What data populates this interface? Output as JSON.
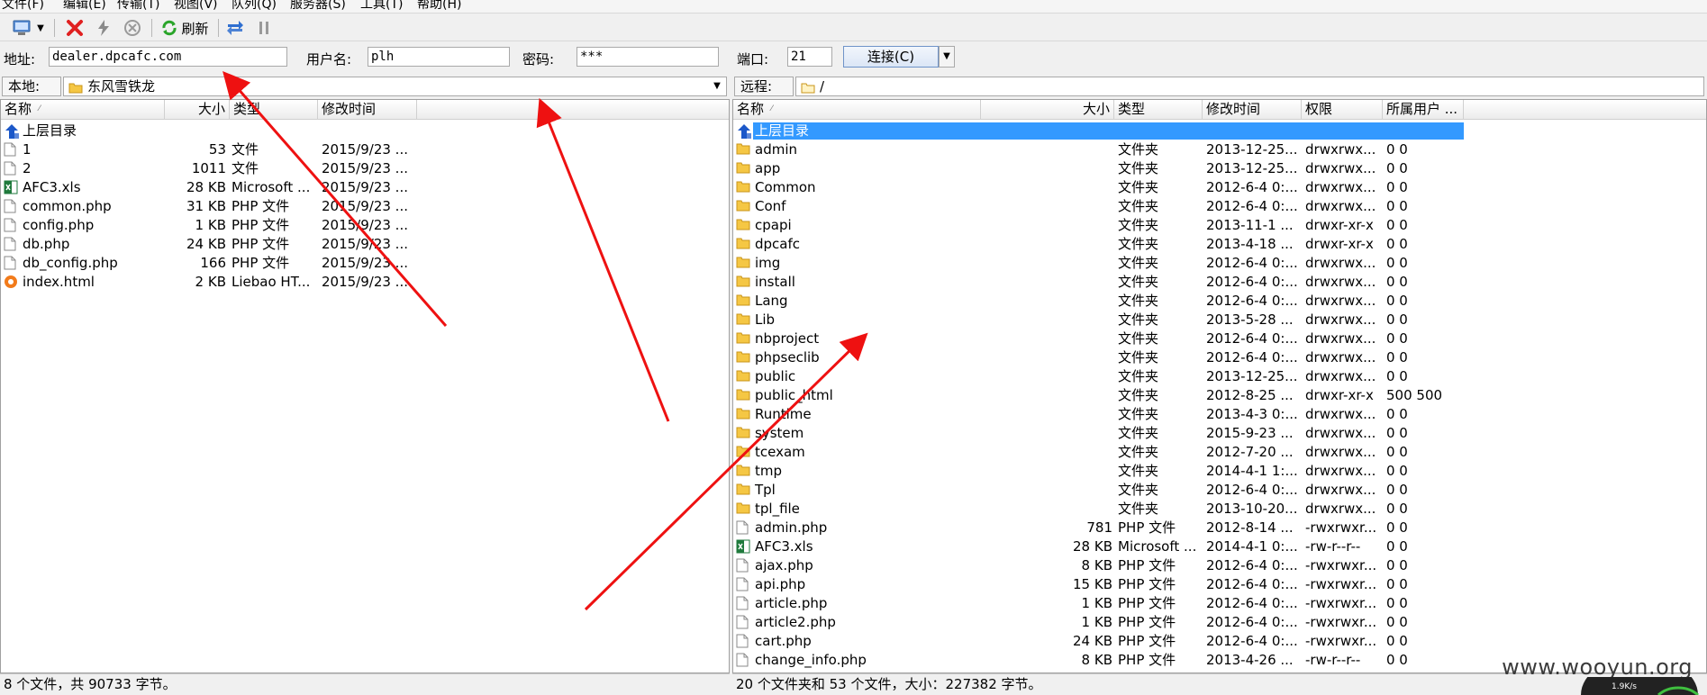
{
  "menu": [
    "文件(F)",
    "编辑(E)",
    "传输(T)",
    "视图(V)",
    "队列(Q)",
    "服务器(S)",
    "工具(T)",
    "帮助(H)"
  ],
  "toolbar": {
    "refresh_label": "刷新"
  },
  "connection": {
    "address_label": "地址:",
    "address_value": "dealer.dpcafc.com",
    "user_label": "用户名:",
    "user_value": "plh",
    "password_label": "密码:",
    "password_value": "***",
    "port_label": "端口:",
    "port_value": "21",
    "connect_label": "连接(C)"
  },
  "local": {
    "path_label": "本地:",
    "path_value": "东风雪铁龙",
    "columns": [
      "名称",
      "大小",
      "类型",
      "修改时间"
    ],
    "parent_label": "上层目录",
    "files": [
      {
        "name": "1",
        "size": "53",
        "type": "文件",
        "modified": "2015/9/23 ...",
        "icon": "file"
      },
      {
        "name": "2",
        "size": "1011",
        "type": "文件",
        "modified": "2015/9/23 ...",
        "icon": "file"
      },
      {
        "name": "AFC3.xls",
        "size": "28 KB",
        "type": "Microsoft ...",
        "modified": "2015/9/23 ...",
        "icon": "excel"
      },
      {
        "name": "common.php",
        "size": "31 KB",
        "type": "PHP 文件",
        "modified": "2015/9/23 ...",
        "icon": "file"
      },
      {
        "name": "config.php",
        "size": "1 KB",
        "type": "PHP 文件",
        "modified": "2015/9/23 ...",
        "icon": "file"
      },
      {
        "name": "db.php",
        "size": "24 KB",
        "type": "PHP 文件",
        "modified": "2015/9/23 ...",
        "icon": "file"
      },
      {
        "name": "db_config.php",
        "size": "166",
        "type": "PHP 文件",
        "modified": "2015/9/23 ...",
        "icon": "file"
      },
      {
        "name": "index.html",
        "size": "2 KB",
        "type": "Liebao HT...",
        "modified": "2015/9/23 ...",
        "icon": "html"
      }
    ],
    "status": "8 个文件，共 90733 字节。"
  },
  "remote": {
    "path_label": "远程:",
    "path_value": "/",
    "columns": [
      "名称",
      "大小",
      "类型",
      "修改时间",
      "权限",
      "所属用户 ..."
    ],
    "parent_label": "上层目录",
    "files": [
      {
        "name": "admin",
        "size": "",
        "type": "文件夹",
        "modified": "2013-12-25...",
        "perm": "drwxrwx...",
        "owner": "0 0",
        "icon": "folder"
      },
      {
        "name": "app",
        "size": "",
        "type": "文件夹",
        "modified": "2013-12-25...",
        "perm": "drwxrwx...",
        "owner": "0 0",
        "icon": "folder"
      },
      {
        "name": "Common",
        "size": "",
        "type": "文件夹",
        "modified": "2012-6-4 0:...",
        "perm": "drwxrwx...",
        "owner": "0 0",
        "icon": "folder"
      },
      {
        "name": "Conf",
        "size": "",
        "type": "文件夹",
        "modified": "2012-6-4 0:...",
        "perm": "drwxrwx...",
        "owner": "0 0",
        "icon": "folder"
      },
      {
        "name": "cpapi",
        "size": "",
        "type": "文件夹",
        "modified": "2013-11-1 ...",
        "perm": "drwxr-xr-x",
        "owner": "0 0",
        "icon": "folder"
      },
      {
        "name": "dpcafc",
        "size": "",
        "type": "文件夹",
        "modified": "2013-4-18 ...",
        "perm": "drwxr-xr-x",
        "owner": "0 0",
        "icon": "folder"
      },
      {
        "name": "img",
        "size": "",
        "type": "文件夹",
        "modified": "2012-6-4 0:...",
        "perm": "drwxrwx...",
        "owner": "0 0",
        "icon": "folder"
      },
      {
        "name": "install",
        "size": "",
        "type": "文件夹",
        "modified": "2012-6-4 0:...",
        "perm": "drwxrwx...",
        "owner": "0 0",
        "icon": "folder"
      },
      {
        "name": "Lang",
        "size": "",
        "type": "文件夹",
        "modified": "2012-6-4 0:...",
        "perm": "drwxrwx...",
        "owner": "0 0",
        "icon": "folder"
      },
      {
        "name": "Lib",
        "size": "",
        "type": "文件夹",
        "modified": "2013-5-28 ...",
        "perm": "drwxrwx...",
        "owner": "0 0",
        "icon": "folder"
      },
      {
        "name": "nbproject",
        "size": "",
        "type": "文件夹",
        "modified": "2012-6-4 0:...",
        "perm": "drwxrwx...",
        "owner": "0 0",
        "icon": "folder"
      },
      {
        "name": "phpseclib",
        "size": "",
        "type": "文件夹",
        "modified": "2012-6-4 0:...",
        "perm": "drwxrwx...",
        "owner": "0 0",
        "icon": "folder"
      },
      {
        "name": "public",
        "size": "",
        "type": "文件夹",
        "modified": "2013-12-25...",
        "perm": "drwxrwx...",
        "owner": "0 0",
        "icon": "folder"
      },
      {
        "name": "public_html",
        "size": "",
        "type": "文件夹",
        "modified": "2012-8-25 ...",
        "perm": "drwxr-xr-x",
        "owner": "500 500",
        "icon": "folder"
      },
      {
        "name": "Runtime",
        "size": "",
        "type": "文件夹",
        "modified": "2013-4-3 0:...",
        "perm": "drwxrwx...",
        "owner": "0 0",
        "icon": "folder"
      },
      {
        "name": "system",
        "size": "",
        "type": "文件夹",
        "modified": "2015-9-23 ...",
        "perm": "drwxrwx...",
        "owner": "0 0",
        "icon": "folder"
      },
      {
        "name": "tcexam",
        "size": "",
        "type": "文件夹",
        "modified": "2012-7-20 ...",
        "perm": "drwxrwx...",
        "owner": "0 0",
        "icon": "folder"
      },
      {
        "name": "tmp",
        "size": "",
        "type": "文件夹",
        "modified": "2014-4-1 1:...",
        "perm": "drwxrwx...",
        "owner": "0 0",
        "icon": "folder"
      },
      {
        "name": "Tpl",
        "size": "",
        "type": "文件夹",
        "modified": "2012-6-4 0:...",
        "perm": "drwxrwx...",
        "owner": "0 0",
        "icon": "folder"
      },
      {
        "name": "tpl_file",
        "size": "",
        "type": "文件夹",
        "modified": "2013-10-20...",
        "perm": "drwxrwx...",
        "owner": "0 0",
        "icon": "folder"
      },
      {
        "name": "admin.php",
        "size": "781",
        "type": "PHP 文件",
        "modified": "2012-8-14 ...",
        "perm": "-rwxrwxr...",
        "owner": "0 0",
        "icon": "file"
      },
      {
        "name": "AFC3.xls",
        "size": "28 KB",
        "type": "Microsoft ...",
        "modified": "2014-4-1 0:...",
        "perm": "-rw-r--r--",
        "owner": "0 0",
        "icon": "excel"
      },
      {
        "name": "ajax.php",
        "size": "8 KB",
        "type": "PHP 文件",
        "modified": "2012-6-4 0:...",
        "perm": "-rwxrwxr...",
        "owner": "0 0",
        "icon": "file"
      },
      {
        "name": "api.php",
        "size": "15 KB",
        "type": "PHP 文件",
        "modified": "2012-6-4 0:...",
        "perm": "-rwxrwxr...",
        "owner": "0 0",
        "icon": "file"
      },
      {
        "name": "article.php",
        "size": "1 KB",
        "type": "PHP 文件",
        "modified": "2012-6-4 0:...",
        "perm": "-rwxrwxr...",
        "owner": "0 0",
        "icon": "file"
      },
      {
        "name": "article2.php",
        "size": "1 KB",
        "type": "PHP 文件",
        "modified": "2012-6-4 0:...",
        "perm": "-rwxrwxr...",
        "owner": "0 0",
        "icon": "file"
      },
      {
        "name": "cart.php",
        "size": "24 KB",
        "type": "PHP 文件",
        "modified": "2012-6-4 0:...",
        "perm": "-rwxrwxr...",
        "owner": "0 0",
        "icon": "file"
      },
      {
        "name": "change_info.php",
        "size": "8 KB",
        "type": "PHP 文件",
        "modified": "2013-4-26 ...",
        "perm": "-rw-r--r--",
        "owner": "0 0",
        "icon": "file"
      }
    ],
    "status": "20 个文件夹和 53 个文件，大小：227382 字节。"
  },
  "watermark": "www.wooyun.org",
  "gauge_text": "1.9K/s",
  "colors": {
    "selection": "#3399ff",
    "arrow": "#ee1111",
    "folder": "#f5c744"
  }
}
